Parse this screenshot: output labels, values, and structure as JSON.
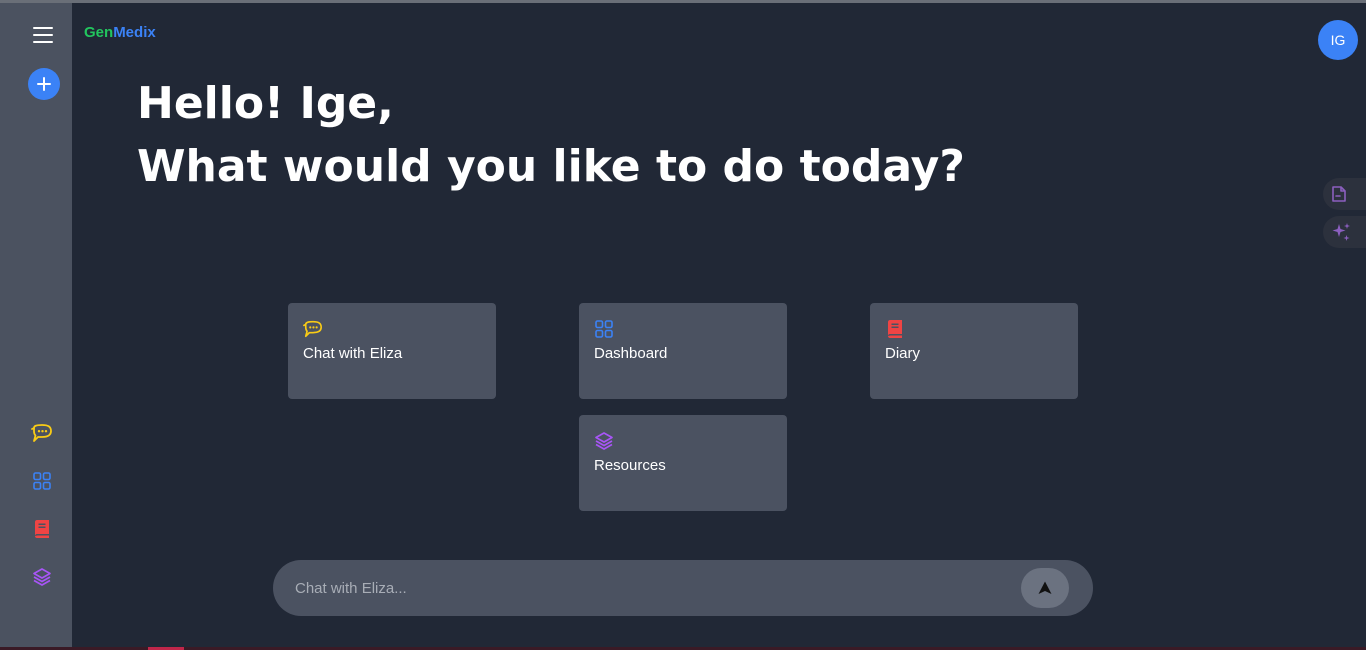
{
  "app": {
    "logo_part1": "Gen",
    "logo_part2": "Medix"
  },
  "user": {
    "initials": "IG"
  },
  "greeting": {
    "line1": "Hello! Ige,",
    "line2": "What would you like to do today?"
  },
  "cards": [
    {
      "label": "Chat with Eliza",
      "icon": "chat-bubble-icon",
      "color": "#facc15"
    },
    {
      "label": "Dashboard",
      "icon": "grid-icon",
      "color": "#3b82f6"
    },
    {
      "label": "Diary",
      "icon": "book-icon",
      "color": "#ef4444"
    },
    {
      "label": "Resources",
      "icon": "layers-icon",
      "color": "#a855f7"
    }
  ],
  "sidebar": {
    "icons": [
      {
        "icon": "chat-bubble-icon",
        "color": "#facc15"
      },
      {
        "icon": "grid-icon",
        "color": "#3b82f6"
      },
      {
        "icon": "book-icon",
        "color": "#ef4444"
      },
      {
        "icon": "layers-icon",
        "color": "#a855f7"
      }
    ]
  },
  "right_panel": {
    "icons": [
      "document-icon",
      "sparkles-icon"
    ],
    "icon_color": "#8b5fbf"
  },
  "chat": {
    "placeholder": "Chat with Eliza..."
  },
  "colors": {
    "background": "#212836",
    "sidebar": "#4b5260",
    "card": "#4b5261",
    "accent": "#3b82f6",
    "logo_green": "#22c55e"
  }
}
